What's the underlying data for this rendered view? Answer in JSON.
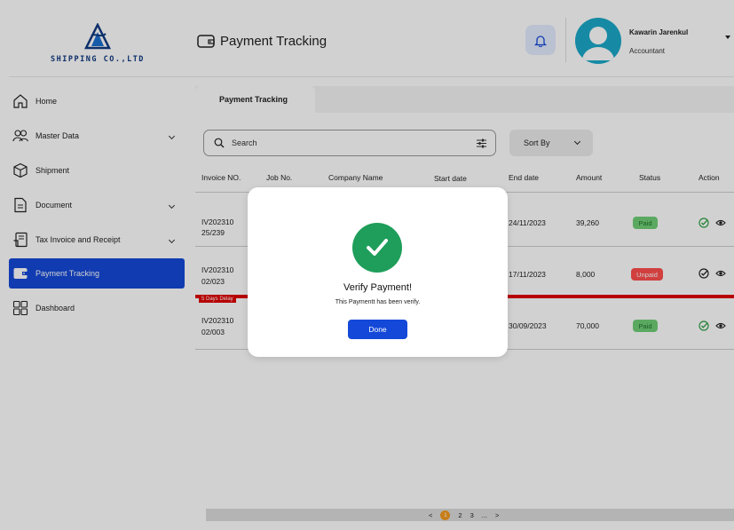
{
  "brand": {
    "name": "SHIPPING CO.,LTD",
    "color": "#0f3a82"
  },
  "header": {
    "page_title": "Payment Tracking",
    "page_icon": "wallet-icon",
    "notification_icon": "bell-icon",
    "user": {
      "name": "Kawarin Jarenkul",
      "role": "Accountant"
    }
  },
  "sidebar": {
    "items": [
      {
        "label": "Home",
        "icon": "home-icon",
        "has_submenu": false,
        "active": false
      },
      {
        "label": "Master Data",
        "icon": "users-icon",
        "has_submenu": true,
        "active": false
      },
      {
        "label": "Shipment",
        "icon": "box-icon",
        "has_submenu": false,
        "active": false
      },
      {
        "label": "Document",
        "icon": "document-icon",
        "has_submenu": true,
        "active": false
      },
      {
        "label": "Tax Invoice and Receipt",
        "icon": "receipt-icon",
        "has_submenu": true,
        "active": false
      },
      {
        "label": "Payment Tracking",
        "icon": "wallet-icon",
        "has_submenu": false,
        "active": true
      },
      {
        "label": "Dashboard",
        "icon": "dashboard-icon",
        "has_submenu": false,
        "active": false
      }
    ],
    "active_color": "#1448d8"
  },
  "main": {
    "tab_label": "Payment Tracking",
    "search": {
      "placeholder": "Search"
    },
    "sort": {
      "label": "Sort By"
    },
    "table": {
      "columns": [
        "Invoice NO.",
        "Job No.",
        "Company Name",
        "Start date",
        "End date",
        "Amount",
        "Status",
        "Action"
      ],
      "rows": [
        {
          "invoice_line1": "IV202310",
          "invoice_line2": "25/239",
          "end_date": "24/11/2023",
          "amount": "39,260",
          "status": "Paid",
          "delay": ""
        },
        {
          "invoice_line1": "IV202310",
          "invoice_line2": "02/023",
          "end_date": "17/11/2023",
          "amount": "8,000",
          "status": "Unpaid",
          "delay": "5 Days Delay"
        },
        {
          "invoice_line1": "IV202310",
          "invoice_line2": "02/003",
          "end_date": "30/09/2023",
          "amount": "70,000",
          "status": "Paid",
          "delay": ""
        }
      ]
    },
    "pagination": {
      "prev": "<",
      "pages": [
        "1",
        "2",
        "3",
        "..."
      ],
      "current": "1",
      "next": ">"
    }
  },
  "modal": {
    "title": "Verify Payment!",
    "message": "This Paymentt has been verify.",
    "button": "Done",
    "icon": "check-circle-icon",
    "success_color": "#1e9e5a"
  },
  "colors": {
    "paid": "#6fcf77",
    "unpaid": "#ff4d4d",
    "delay": "#e00000",
    "page_current": "#f39a1e"
  }
}
